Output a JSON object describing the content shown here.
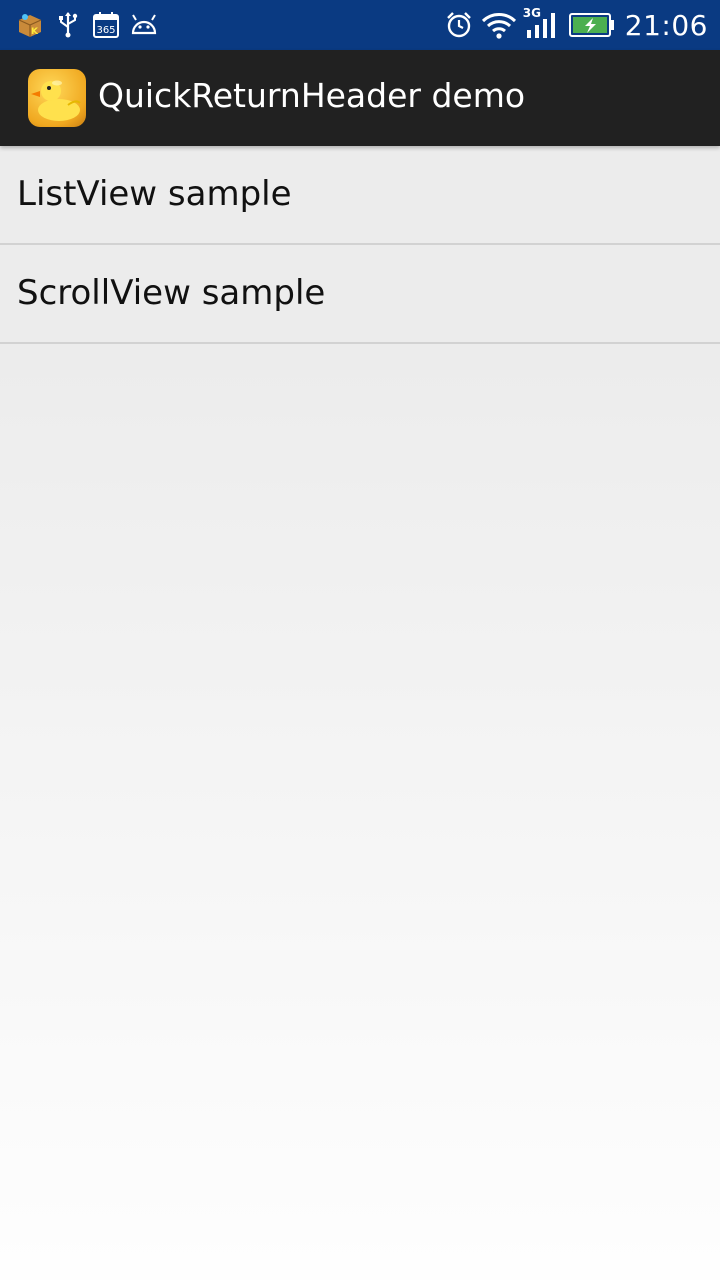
{
  "status_bar": {
    "background_color": "#0a3a82",
    "left_icons": [
      "app-notification-icon",
      "usb-icon",
      "calendar-icon",
      "android-debug-icon"
    ],
    "calendar_number": "365",
    "network_type": "3G",
    "right_icons": [
      "alarm-icon",
      "wifi-icon",
      "cell-signal-icon",
      "battery-charging-icon"
    ],
    "time": "21:06"
  },
  "action_bar": {
    "background_color": "#212121",
    "icon": "rubber-duck-icon",
    "title": "QuickReturnHeader demo"
  },
  "list": {
    "items": [
      {
        "label": "ListView sample"
      },
      {
        "label": "ScrollView sample"
      }
    ]
  }
}
